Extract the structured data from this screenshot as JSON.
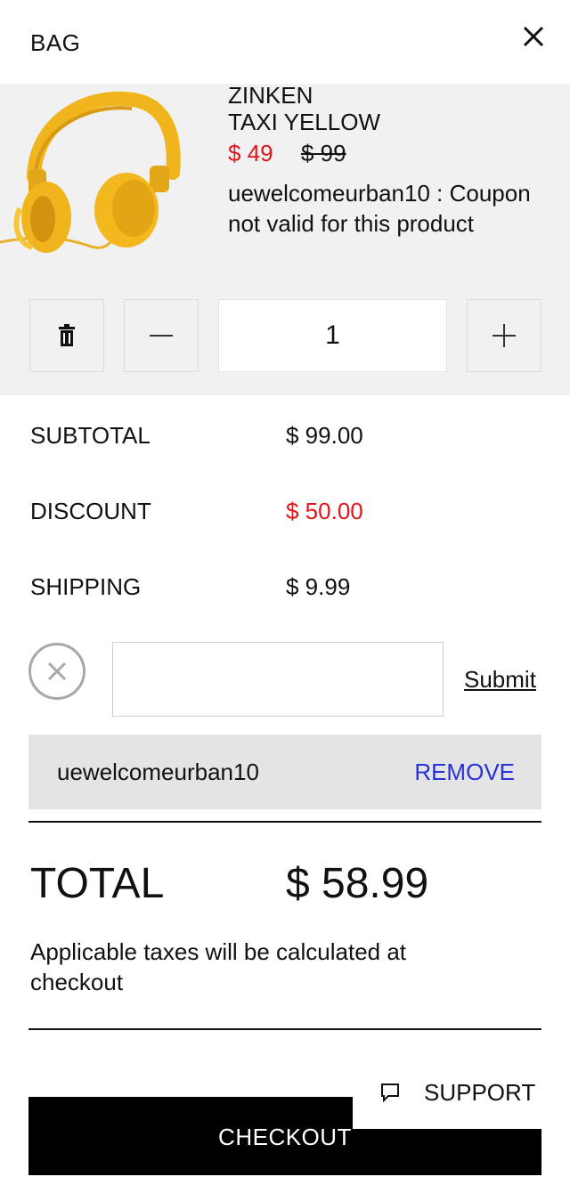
{
  "header": {
    "title": "BAG",
    "close_icon": "close-icon"
  },
  "item": {
    "name_line1": "ZINKEN",
    "name_line2": "TAXI YELLOW",
    "price_sale": "$ 49",
    "price_original": "$ 99",
    "coupon_message": "uewelcomeurban10 : Coupon not valid for this product",
    "image_icon": "headphones-image",
    "quantity": "1"
  },
  "summary": {
    "subtotal_label": "SUBTOTAL",
    "subtotal_value": "$ 99.00",
    "discount_label": "DISCOUNT",
    "discount_value": "$ 50.00",
    "shipping_label": "SHIPPING",
    "shipping_value": "$ 9.99"
  },
  "coupon": {
    "input_value": "",
    "input_placeholder": "",
    "submit_label": "Submit",
    "applied_code": "uewelcomeurban10",
    "remove_label": "REMOVE"
  },
  "total": {
    "label": "TOTAL",
    "value": "$ 58.99",
    "tax_note": "Applicable taxes will be calculated at checkout"
  },
  "support_label": "SUPPORT",
  "checkout_label": "CHECKOUT",
  "colors": {
    "accent_red": "#e0161b",
    "link_blue": "#2631d8",
    "product_yellow": "#f0b51d"
  }
}
